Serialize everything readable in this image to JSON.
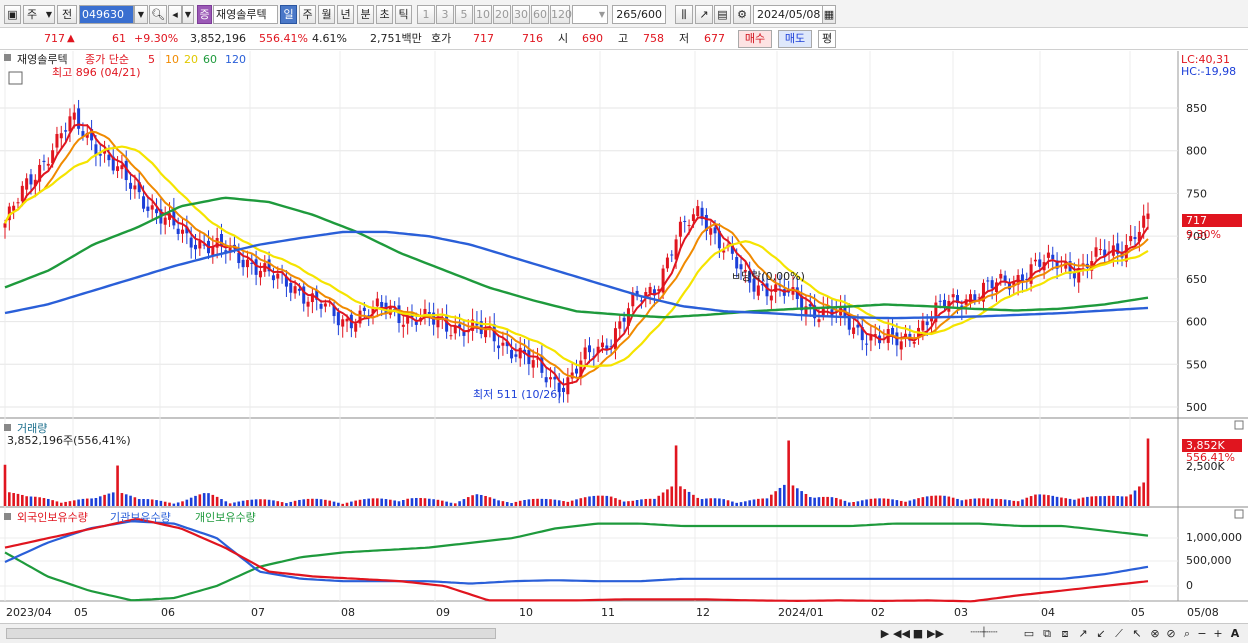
{
  "toolbar": {
    "market_type": "주",
    "full_label": "전",
    "code": "049630",
    "name_badge": "증",
    "stock_name": "재영솔루텍",
    "period_buttons": [
      "일",
      "주",
      "월",
      "년",
      "분",
      "초",
      "틱"
    ],
    "interval_buttons": [
      "1",
      "3",
      "5",
      "10",
      "20",
      "30",
      "60",
      "120"
    ],
    "count_value": "265",
    "count_total": "/600",
    "date": "2024/05/08"
  },
  "quote": {
    "price": "717",
    "change": "61",
    "change_pct": "+9.30%",
    "volume": "3,852,196",
    "volume_ratio": "556.41%",
    "turnover": "4.61%",
    "amount": "2,751백만",
    "hoga_label": "호가",
    "ask": "717",
    "bid": "716",
    "open_label": "시",
    "open": "690",
    "high_label": "고",
    "high": "758",
    "low_label": "저",
    "low": "677",
    "buy_label": "매수",
    "sell_label": "매도",
    "eval_label": "평"
  },
  "price_panel": {
    "name": "재영솔루텍",
    "ma_label": "종가 단순",
    "ma_periods": [
      "5",
      "10",
      "20",
      "60",
      "120"
    ],
    "ma_colors": [
      "#e0151f",
      "#f08a00",
      "#f5e400",
      "#1e9a3c",
      "#2a5fd8"
    ],
    "lc": "LC:40,31",
    "hc": "HC:-19,98",
    "high_note": "최고 896 (04/21)",
    "low_note": "최저 511 (10/26)",
    "cursor_note": "ㅂ당락(0,00%)",
    "last_price_tag": "717",
    "last_pct_tag": "9.30%",
    "y_ticks": [
      "850",
      "800",
      "750",
      "700",
      "650",
      "600",
      "550",
      "500"
    ]
  },
  "volume_panel": {
    "title": "거래량",
    "value": "3,852,196주(556,41%)",
    "tag_value": "3,852K",
    "tag_pct": "556.41%",
    "axis_label": "2,500K"
  },
  "holding_panel": {
    "legend": [
      "외국인보유수량",
      "기관보유수량",
      "개인보유수량"
    ],
    "colors": [
      "#e0151f",
      "#2a5fd8",
      "#1e9a3c"
    ],
    "y_ticks": [
      "1,000,000",
      "500,000",
      "0"
    ]
  },
  "x_axis": [
    "2023/04",
    "05",
    "06",
    "07",
    "08",
    "09",
    "10",
    "11",
    "12",
    "2024/01",
    "02",
    "03",
    "04",
    "05",
    "05/08"
  ],
  "chart_data": {
    "type": "candlestick",
    "title": "재영솔루텍",
    "x": [
      "2023/04",
      "05",
      "06",
      "07",
      "08",
      "09",
      "10",
      "11",
      "12",
      "2024/01",
      "02",
      "03",
      "04",
      "05"
    ],
    "ylim": [
      490,
      905
    ],
    "close_series": [
      715,
      760,
      800,
      835,
      810,
      775,
      750,
      720,
      700,
      690,
      680,
      670,
      650,
      640,
      620,
      600,
      610,
      615,
      605,
      600,
      595,
      590,
      580,
      560,
      540,
      525,
      560,
      580,
      620,
      640,
      700,
      730,
      690,
      650,
      640,
      630,
      615,
      610,
      590,
      580,
      575,
      600,
      620,
      630,
      640,
      650,
      665,
      670,
      660,
      680,
      690,
      717
    ],
    "ma120_series": [
      610,
      620,
      635,
      650,
      665,
      678,
      690,
      698,
      705,
      705,
      700,
      690,
      675,
      660,
      645,
      630,
      618,
      612,
      610,
      607,
      605,
      604,
      605,
      606,
      608,
      610,
      613,
      616
    ],
    "ma60_series": [
      640,
      660,
      690,
      710,
      735,
      745,
      740,
      725,
      705,
      680,
      660,
      640,
      625,
      612,
      608,
      605,
      608,
      612,
      615,
      617,
      620,
      618,
      615,
      613,
      615,
      620,
      628
    ],
    "volume_series": [
      0.55,
      0.2,
      0.15,
      0.1,
      0.12,
      0.55,
      0.1,
      0.08,
      0.1,
      0.35,
      0.1,
      0.08,
      0.1,
      0.12,
      0.1,
      0.08,
      0.1,
      0.15,
      0.2,
      0.1,
      0.08,
      0.3,
      0.1,
      0.12,
      0.1,
      0.15,
      0.2,
      0.25,
      0.12,
      0.1,
      0.85,
      0.1,
      0.15,
      0.1,
      0.12,
      0.9,
      0.15,
      0.2,
      0.1,
      0.12,
      0.15,
      0.2,
      0.25,
      0.2,
      0.1,
      0.15,
      0.3,
      0.2,
      0.25,
      0.2,
      0.3,
      0.9
    ],
    "foreign_series": [
      800000,
      1000000,
      1200000,
      1400000,
      1200000,
      800000,
      300000,
      200000,
      150000,
      100000,
      0,
      -300000,
      -300000,
      -300000,
      -280000,
      -280000,
      -280000,
      -300000,
      -310000,
      -300000,
      -310000,
      -300000,
      -320000,
      -200000,
      -100000,
      0,
      100000
    ],
    "institution_series": [
      500000,
      900000,
      1200000,
      1350000,
      1300000,
      1000000,
      300000,
      150000,
      100000,
      100000,
      100000,
      50000,
      100000,
      120000,
      100000,
      100000,
      150000,
      150000,
      150000,
      150000,
      150000,
      150000,
      150000,
      150000,
      150000,
      150000,
      250000,
      400000
    ],
    "individual_series": [
      700000,
      200000,
      -100000,
      -300000,
      -250000,
      0,
      400000,
      600000,
      700000,
      750000,
      800000,
      900000,
      1000000,
      1200000,
      1300000,
      1300000,
      1250000,
      1250000,
      1250000,
      1250000,
      1250000,
      1300000,
      1300000,
      1300000,
      1250000,
      1250000,
      1150000,
      1050000
    ]
  }
}
